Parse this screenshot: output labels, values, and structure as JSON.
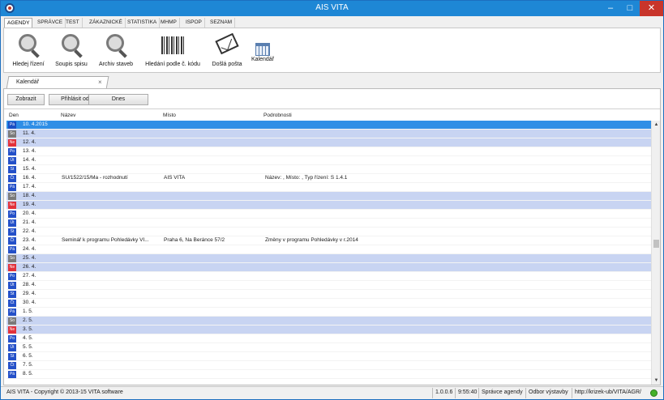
{
  "window": {
    "title": "AIS VITA",
    "controls": {
      "minimize": "–",
      "maximize": "□",
      "close": "✕"
    }
  },
  "ribbon_tabs": [
    "AGENDY",
    "SPRÁVCE",
    "TEST",
    "ZÁKAZNICKÉ",
    "STATISTIKA",
    "MHMP",
    "ISPOP",
    "SEZNAM"
  ],
  "ribbon": {
    "buttons": [
      {
        "label": "Hledej řízení",
        "icon": "magnifier-icon"
      },
      {
        "label": "Soupis spisu",
        "icon": "magnifier-icon"
      },
      {
        "label": "Archiv staveb",
        "icon": "magnifier-icon"
      },
      {
        "label": "Hledání podle č. kódu",
        "icon": "barcode-icon"
      },
      {
        "label": "Došlá pošta",
        "icon": "mail-icon"
      },
      {
        "label": "Kalendář",
        "icon": "calendar-icon"
      }
    ]
  },
  "doc_tab": {
    "label": "Kalendář",
    "close": "×"
  },
  "toolbar": {
    "show": "Zobrazit",
    "subscribe": "Přihlásit odběr",
    "today": "Dnes"
  },
  "columns": {
    "day": "Den",
    "name": "Název",
    "place": "Místo",
    "details": "Podrobnosti"
  },
  "rows": [
    {
      "day": "Pá",
      "date": "10.  4.2015",
      "name": "",
      "place": "",
      "details": ""
    },
    {
      "day": "So",
      "date": "11.  4.",
      "name": "",
      "place": "",
      "details": ""
    },
    {
      "day": "Ne",
      "date": "12.  4.",
      "name": "",
      "place": "",
      "details": ""
    },
    {
      "day": "Po",
      "date": "13.  4.",
      "name": "",
      "place": "",
      "details": ""
    },
    {
      "day": "Út",
      "date": "14.  4.",
      "name": "",
      "place": "",
      "details": ""
    },
    {
      "day": "St",
      "date": "15.  4.",
      "name": "",
      "place": "",
      "details": ""
    },
    {
      "day": "Čt",
      "date": "16.  4.",
      "name": "SU/1522/15/Ma - rozhodnutí",
      "place": "AIS VITA",
      "details": "Název: , Místo: , Typ řízení: S   1.4.1"
    },
    {
      "day": "Pá",
      "date": "17.  4.",
      "name": "",
      "place": "",
      "details": ""
    },
    {
      "day": "So",
      "date": "18.  4.",
      "name": "",
      "place": "",
      "details": ""
    },
    {
      "day": "Ne",
      "date": "19.  4.",
      "name": "",
      "place": "",
      "details": ""
    },
    {
      "day": "Po",
      "date": "20.  4.",
      "name": "",
      "place": "",
      "details": ""
    },
    {
      "day": "Út",
      "date": "21.  4.",
      "name": "",
      "place": "",
      "details": ""
    },
    {
      "day": "St",
      "date": "22.  4.",
      "name": "",
      "place": "",
      "details": ""
    },
    {
      "day": "Čt",
      "date": "23.  4.",
      "name": "Seminář k programu Pohledávky VI...",
      "place": "Praha 6, Na Beránce 57/2",
      "details": "Změny v programu Pohledávky v r.2014"
    },
    {
      "day": "Pá",
      "date": "24.  4.",
      "name": "",
      "place": "",
      "details": ""
    },
    {
      "day": "So",
      "date": "25.  4.",
      "name": "",
      "place": "",
      "details": ""
    },
    {
      "day": "Ne",
      "date": "26.  4.",
      "name": "",
      "place": "",
      "details": ""
    },
    {
      "day": "Po",
      "date": "27.  4.",
      "name": "",
      "place": "",
      "details": ""
    },
    {
      "day": "Út",
      "date": "28.  4.",
      "name": "",
      "place": "",
      "details": ""
    },
    {
      "day": "St",
      "date": "29.  4.",
      "name": "",
      "place": "",
      "details": ""
    },
    {
      "day": "Čt",
      "date": "30.  4.",
      "name": "",
      "place": "",
      "details": ""
    },
    {
      "day": "Pá",
      "date": "1.  5.",
      "name": "",
      "place": "",
      "details": ""
    },
    {
      "day": "So",
      "date": "2.  5.",
      "name": "",
      "place": "",
      "details": ""
    },
    {
      "day": "Ne",
      "date": "3.  5.",
      "name": "",
      "place": "",
      "details": ""
    },
    {
      "day": "Po",
      "date": "4.  5.",
      "name": "",
      "place": "",
      "details": ""
    },
    {
      "day": "Út",
      "date": "5.  5.",
      "name": "",
      "place": "",
      "details": ""
    },
    {
      "day": "St",
      "date": "6.  5.",
      "name": "",
      "place": "",
      "details": ""
    },
    {
      "day": "Čt",
      "date": "7.  5.",
      "name": "",
      "place": "",
      "details": ""
    },
    {
      "day": "Pá",
      "date": "8.  5.",
      "name": "",
      "place": "",
      "details": ""
    }
  ],
  "scrollbar": {
    "up": "▲",
    "down": "▼"
  },
  "status": {
    "copyright": "AIS VITA - Copyright © 2013-15 VITA software",
    "version": "1.0.0.6",
    "time": "9:55:40",
    "role": "Správce agendy",
    "department": "Odbor výstavby",
    "url": "http://krizek-ub/VITA/AGR/"
  },
  "colors": {
    "titlebar": "#1e87d5",
    "weekday_badge": "#2450c8",
    "saturday_badge": "#7a7a7a",
    "sunday_badge": "#e2313a",
    "weekend_row": "#c8d4f2",
    "selected_row": "#2f8ee6"
  }
}
